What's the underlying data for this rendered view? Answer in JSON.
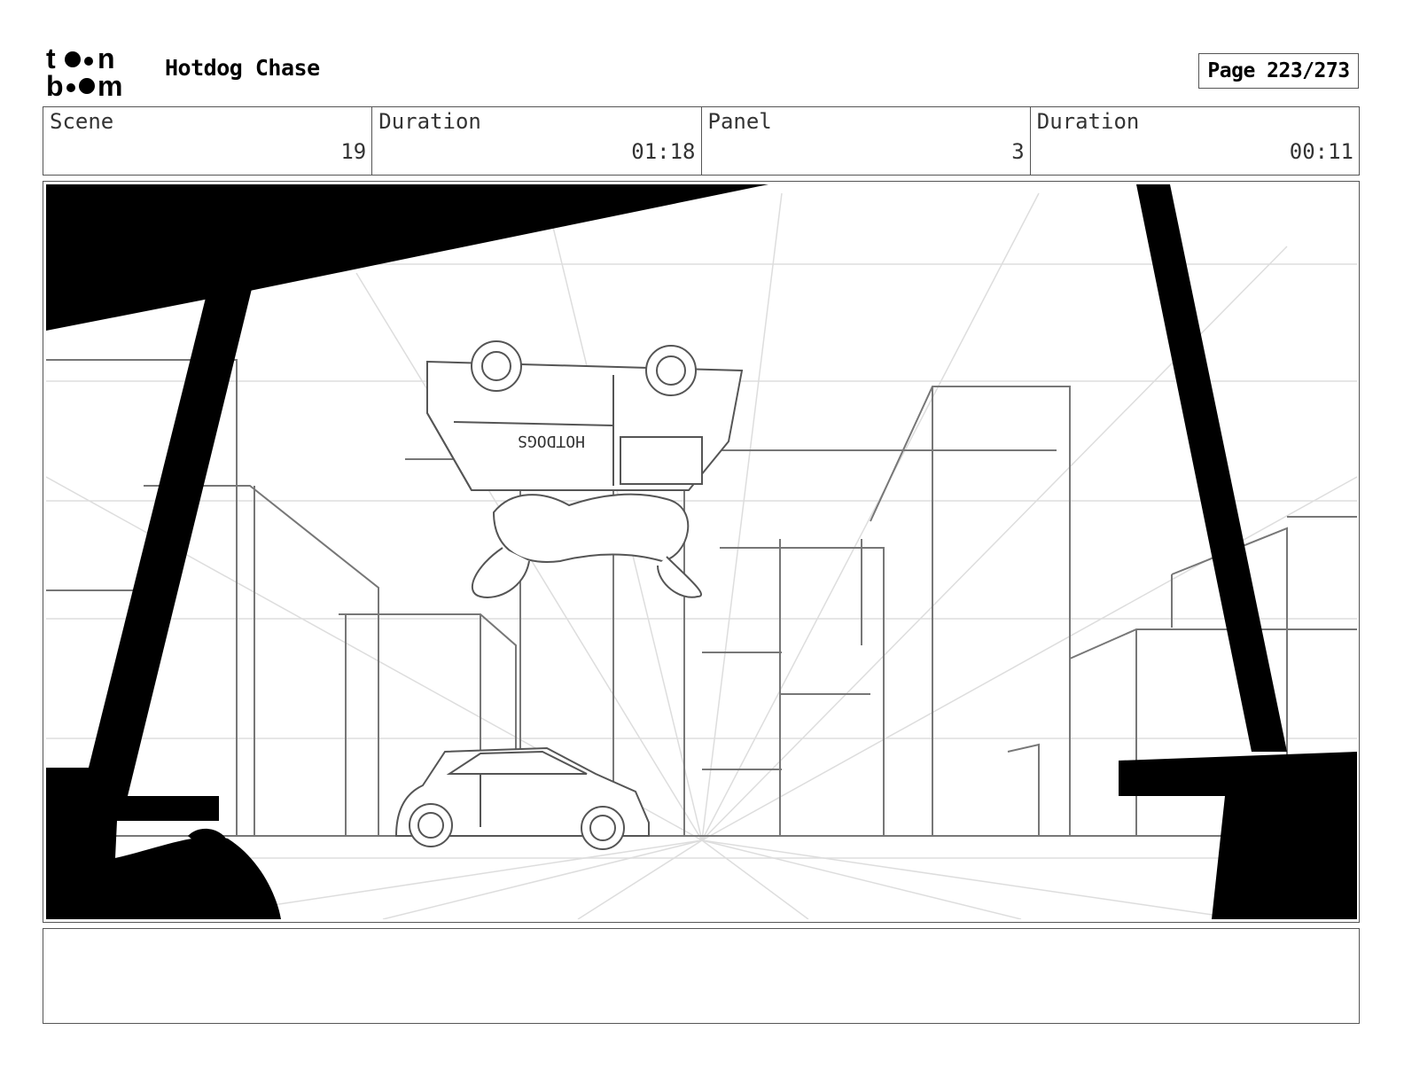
{
  "header": {
    "logo_alt": "toon boom",
    "project_title": "Hotdog Chase",
    "page_label": "Page 223/273"
  },
  "info": {
    "scene_label": "Scene",
    "scene_value": "19",
    "scene_duration_label": "Duration",
    "scene_duration_value": "01:18",
    "panel_label": "Panel",
    "panel_value": "3",
    "panel_duration_label": "Duration",
    "panel_duration_value": "00:11"
  },
  "panel": {
    "truck_sign": "HOTDOGS"
  },
  "notes": {
    "text": ""
  }
}
